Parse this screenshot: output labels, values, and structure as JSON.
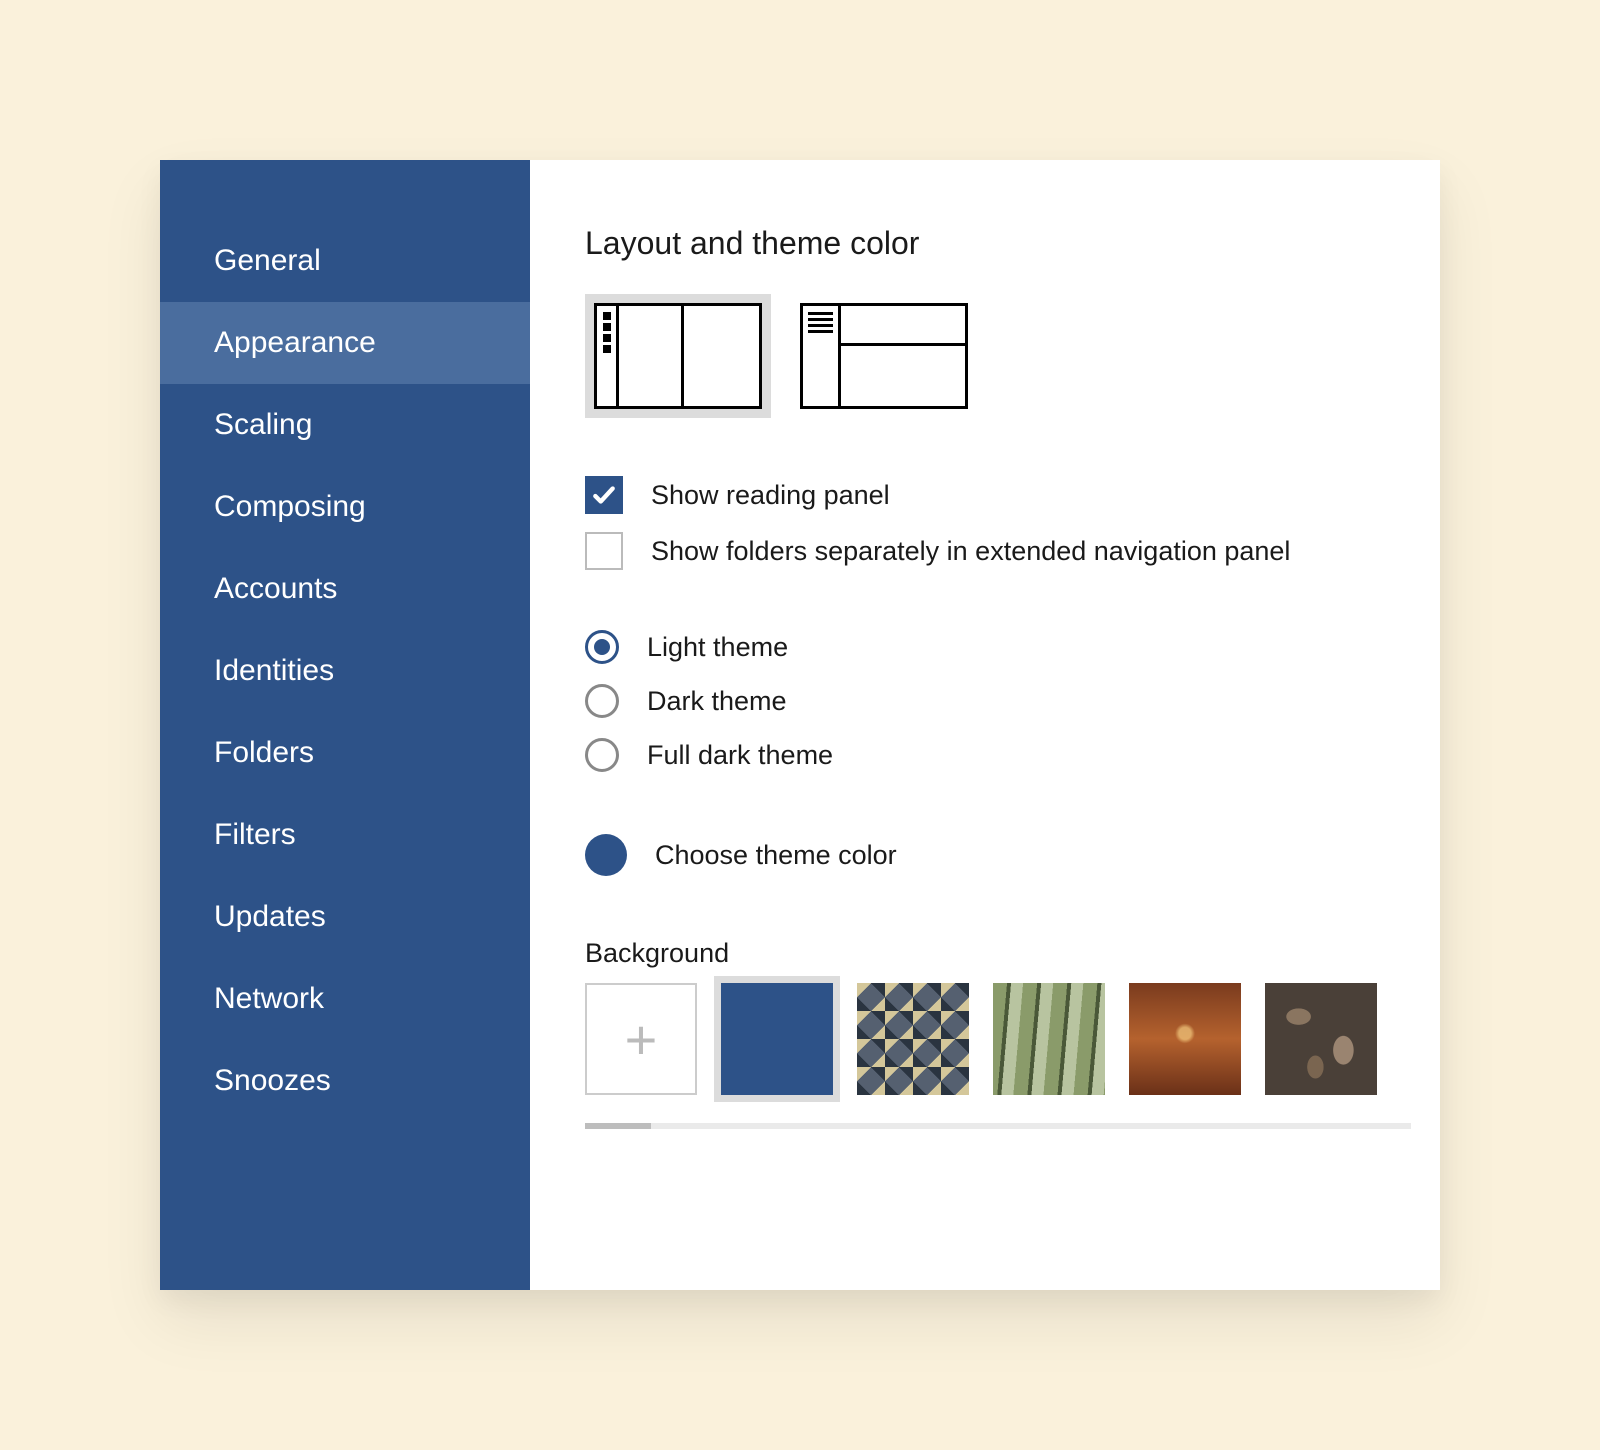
{
  "sidebar": {
    "items": [
      {
        "label": "General",
        "selected": false
      },
      {
        "label": "Appearance",
        "selected": true
      },
      {
        "label": "Scaling",
        "selected": false
      },
      {
        "label": "Composing",
        "selected": false
      },
      {
        "label": "Accounts",
        "selected": false
      },
      {
        "label": "Identities",
        "selected": false
      },
      {
        "label": "Folders",
        "selected": false
      },
      {
        "label": "Filters",
        "selected": false
      },
      {
        "label": "Updates",
        "selected": false
      },
      {
        "label": "Network",
        "selected": false
      },
      {
        "label": "Snoozes",
        "selected": false
      }
    ]
  },
  "main": {
    "section_title": "Layout and theme color",
    "layout_selected_index": 0,
    "checkboxes": [
      {
        "label": "Show reading panel",
        "checked": true
      },
      {
        "label": "Show folders separately in extended navigation panel",
        "checked": false
      }
    ],
    "theme_radios": [
      {
        "label": "Light theme",
        "checked": true
      },
      {
        "label": "Dark theme",
        "checked": false
      },
      {
        "label": "Full dark theme",
        "checked": false
      }
    ],
    "theme_color": {
      "label": "Choose theme color",
      "value": "#2d5288"
    },
    "background": {
      "title": "Background",
      "selected_index": 1
    }
  }
}
